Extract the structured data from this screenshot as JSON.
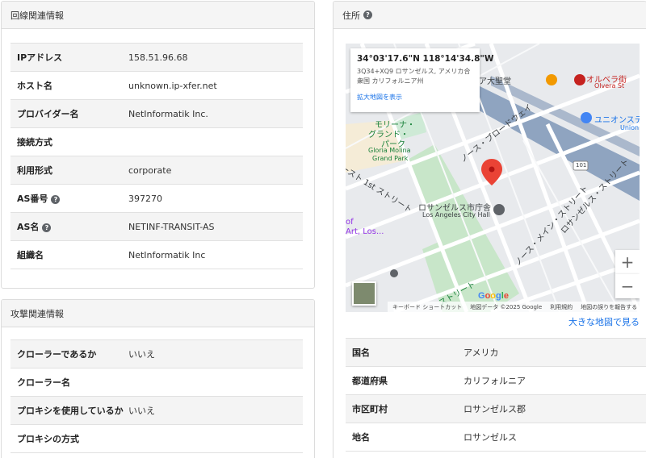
{
  "line_info": {
    "title": "回線関連情報",
    "rows": [
      {
        "key": "IPアドレス",
        "value": "158.51.96.68"
      },
      {
        "key": "ホスト名",
        "value": "unknown.ip-xfer.net"
      },
      {
        "key": "プロバイダー名",
        "value": "NetInformatik Inc."
      },
      {
        "key": "接続方式",
        "value": ""
      },
      {
        "key": "利用形式",
        "value": "corporate"
      },
      {
        "key": "AS番号",
        "value": "397270",
        "help": true
      },
      {
        "key": "AS名",
        "value": "NETINF-TRANSIT-AS",
        "help": true
      },
      {
        "key": "組織名",
        "value": "NetInformatik Inc"
      }
    ]
  },
  "attack_info": {
    "title": "攻撃関連情報",
    "rows": [
      {
        "key": "クローラーであるか",
        "value": "いいえ"
      },
      {
        "key": "クローラー名",
        "value": ""
      },
      {
        "key": "プロキシを使用しているか",
        "value": "いいえ"
      },
      {
        "key": "プロキシの方式",
        "value": ""
      }
    ]
  },
  "address": {
    "title": "住所",
    "help_icon": "?",
    "map": {
      "coords": "34°03'17.6\"N 118°14'34.8\"W",
      "plus_code": "3Q34+XQ9 ロサンゼルス, アメリカ合衆国 カリフォルニア州",
      "larger_map_link": "拡大地図を表示",
      "labels": {
        "cathedral": "ア大聖堂",
        "olvera": "オルベラ街",
        "olvera_en": "Olvera St",
        "union": "ユニオンステー",
        "union_en": "Union",
        "molina": "モリーナ・",
        "grand": "グランド・",
        "park": "パーク",
        "molina_en": "Gloria Molina",
        "grand_park_en": "Grand Park",
        "broadway": "ノース・ブロードウェイ",
        "first_st": "ースト 1st ストリート",
        "city_hall": "ロサンゼルス市庁舎",
        "city_hall_en": "Los Angeles City Hall",
        "main_st": "ノース・メイン・ストリート",
        "la_st": "ロサンゼルス・ストリート",
        "street": "ストリート",
        "art": "Art, Los...",
        "of": "of",
        "hwy": "101"
      },
      "attribution": [
        "キーボード ショートカット",
        "地図データ ©2025 Google",
        "利用規約",
        "地図の誤りを報告する"
      ],
      "google": "Google",
      "zoom_in": "+",
      "zoom_out": "−"
    },
    "big_map_link": "大きな地図で見る",
    "rows": [
      {
        "key": "国名",
        "value": "アメリカ"
      },
      {
        "key": "都道府県",
        "value": "カリフォルニア"
      },
      {
        "key": "市区町村",
        "value": "ロサンゼルス郡"
      },
      {
        "key": "地名",
        "value": "ロサンゼルス"
      }
    ]
  }
}
